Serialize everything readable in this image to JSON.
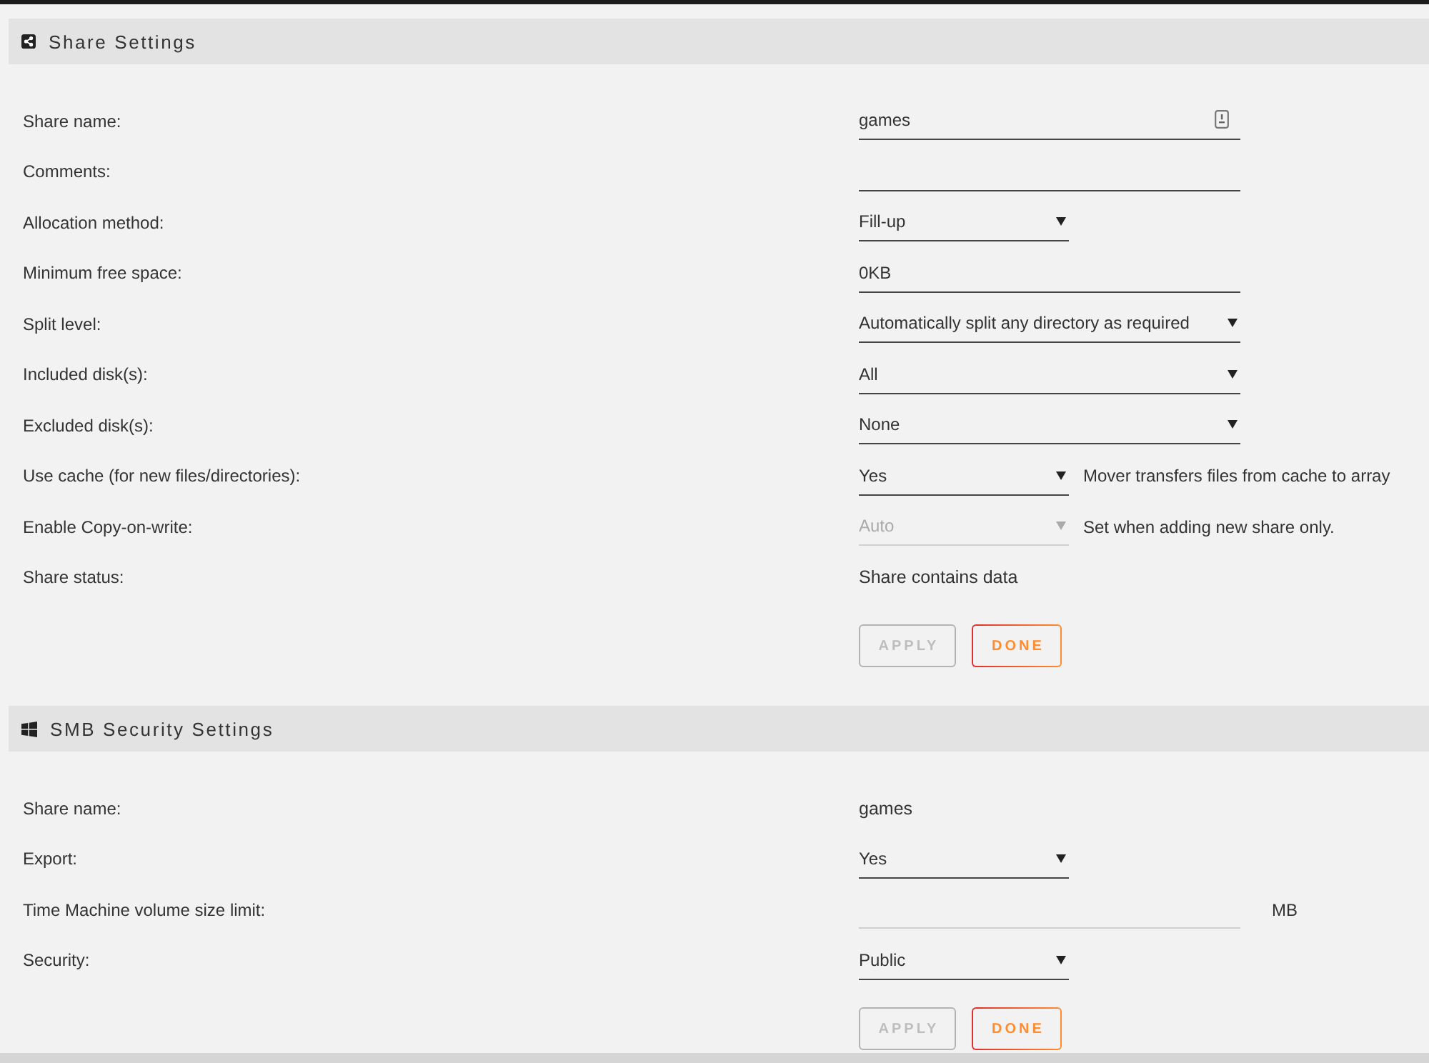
{
  "sections": [
    {
      "title": "Share Settings",
      "rows": [
        {
          "label": "Share name:",
          "kind": "iconfield",
          "value": "games",
          "disabled": false
        },
        {
          "label": "Comments:",
          "kind": "field",
          "disabled": false
        },
        {
          "label": "Allocation method:",
          "kind": "select",
          "value": "Fill-up",
          "disabled": false
        },
        {
          "label": "Minimum free space:",
          "kind": "field",
          "value": "0KB",
          "disabled": false
        },
        {
          "label": "Split level:",
          "kind": "wideselect",
          "value": "Automatically split any directory as required",
          "disabled": false
        },
        {
          "label": "Included disk(s):",
          "kind": "wideselect",
          "value": "All",
          "disabled": false
        },
        {
          "label": "Excluded disk(s):",
          "kind": "wideselect",
          "value": "None",
          "disabled": false
        },
        {
          "label": "Use cache (for new files/directories):",
          "kind": "select",
          "value": "Yes",
          "note": "Mover transfers files from cache to array",
          "disabled": false
        },
        {
          "label": "Enable Copy-on-write:",
          "kind": "select",
          "value": "Auto",
          "note": "Set when adding new share only.",
          "disabled": true
        },
        {
          "label": "Share status:",
          "kind": "static",
          "value": "Share contains data",
          "disabled": false
        }
      ],
      "buttons": [
        {
          "label": "APPLY",
          "disabled": true
        },
        {
          "label": "DONE",
          "disabled": false
        }
      ]
    },
    {
      "title": "SMB Security Settings",
      "rows": [
        {
          "label": "Share name:",
          "kind": "static",
          "value": "games",
          "disabled": false
        },
        {
          "label": "Export:",
          "kind": "select",
          "value": "Yes",
          "disabled": false
        },
        {
          "label": "Time Machine volume size limit:",
          "kind": "unitfield",
          "unit": "MB",
          "disabled": false
        },
        {
          "label": "Security:",
          "kind": "select",
          "value": "Public",
          "disabled": false
        }
      ],
      "buttons": [
        {
          "label": "APPLY",
          "disabled": true
        },
        {
          "label": "DONE",
          "disabled": false
        }
      ]
    }
  ]
}
